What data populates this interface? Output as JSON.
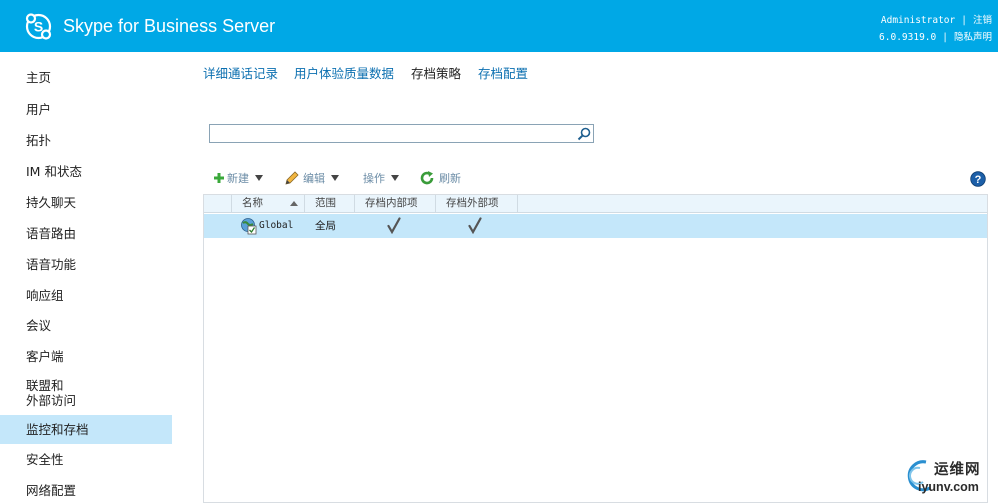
{
  "header": {
    "app_title": "Skype for Business Server",
    "user": "Administrator",
    "signout": "注销",
    "version": "6.0.9319.0",
    "privacy": "隐私声明",
    "background_color": "#00a8e6"
  },
  "sidebar": {
    "items": [
      {
        "label": "主页"
      },
      {
        "label": "用户"
      },
      {
        "label": "拓扑"
      },
      {
        "label": "IM 和状态"
      },
      {
        "label": "持久聊天"
      },
      {
        "label": "语音路由"
      },
      {
        "label": "语音功能"
      },
      {
        "label": "响应组"
      },
      {
        "label": "会议"
      },
      {
        "label": "客户端"
      },
      {
        "label": "联盟和",
        "label2": "外部访问"
      },
      {
        "label": "监控和存档",
        "active": true
      },
      {
        "label": "安全性"
      },
      {
        "label": "网络配置"
      }
    ],
    "active_color": "#c4e7fa"
  },
  "tabs": [
    {
      "label": "详细通话记录"
    },
    {
      "label": "用户体验质量数据"
    },
    {
      "label": "存档策略",
      "active": true
    },
    {
      "label": "存档配置"
    }
  ],
  "search": {
    "value": "",
    "placeholder": ""
  },
  "toolbar": {
    "new_label": "新建",
    "edit_label": "编辑",
    "action_label": "操作",
    "refresh_label": "刷新"
  },
  "grid": {
    "columns": [
      "名称",
      "范围",
      "存档内部项",
      "存档外部项"
    ],
    "rows": [
      {
        "name": "Global",
        "scope": "全局",
        "internal": true,
        "external": true
      }
    ]
  },
  "watermark": {
    "text_cn": "运维网",
    "text_en": "iyunv.com"
  }
}
